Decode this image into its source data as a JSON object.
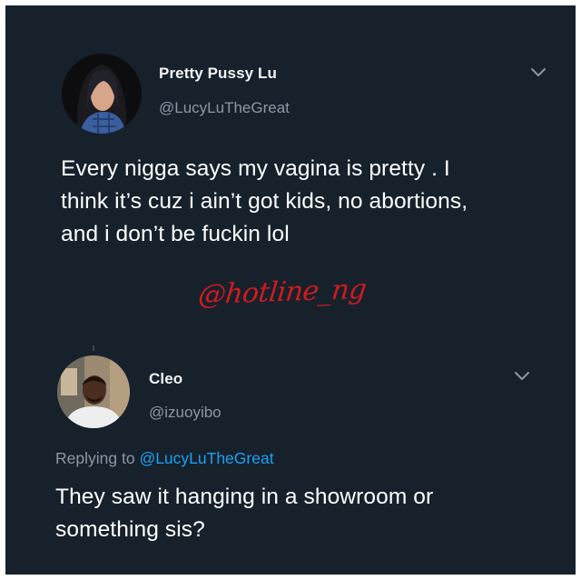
{
  "tweet": {
    "display_name": "Pretty Pussy Lu",
    "handle": "@LucyLuTheGreat",
    "text_lines": [
      "Every nigga says my vagina is pretty . I",
      "think it’s cuz i ain’t got kids, no abortions,",
      "and i don’t be fuckin lol"
    ],
    "menu_icon": "chevron-down-icon"
  },
  "watermark": {
    "text": "@hotline_ng",
    "color": "#d11b1e"
  },
  "reply": {
    "display_name": "Cleo",
    "handle": "@izuoyibo",
    "replying_prefix": "Replying to",
    "replying_to": "@LucyLuTheGreat",
    "text_lines": [
      "They saw it hanging in a showroom or",
      "something sis?"
    ],
    "menu_icon": "chevron-down-icon"
  },
  "colors": {
    "background": "#17212c",
    "primary_text": "#ffffff",
    "secondary_text": "#8b98a5",
    "link": "#1da1f2"
  }
}
